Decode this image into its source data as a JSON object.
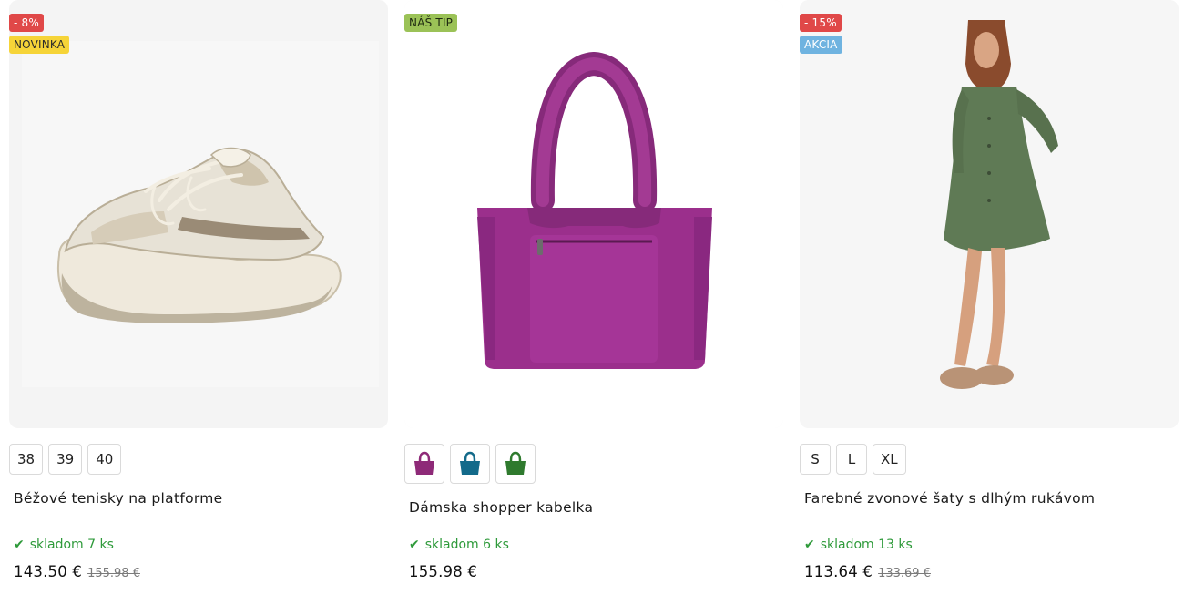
{
  "colors": {
    "badge_discount": "#e04848",
    "badge_new": "#f6d438",
    "badge_tip": "#9bc257",
    "badge_sale": "#6fb3e0",
    "in_stock": "#2e9a3a"
  },
  "products": [
    {
      "badges": [
        "- 8%",
        "NOVINKA"
      ],
      "image": "beige-platform-sneaker",
      "sizes": [
        "38",
        "39",
        "40"
      ],
      "title": "Béžové tenisky na platforme",
      "stock_icon": "check-icon",
      "stock": "skladom 7 ks",
      "price": "143.50 €",
      "old_price": "155.98 €"
    },
    {
      "badges": [
        "NÁŠ TIP"
      ],
      "image": "purple-shopper-bag",
      "swatches": [
        {
          "name": "purple",
          "color": "#8e2a78"
        },
        {
          "name": "teal",
          "color": "#136a8a"
        },
        {
          "name": "green",
          "color": "#2f7a2e"
        }
      ],
      "title": "Dámska shopper kabelka",
      "stock_icon": "check-icon",
      "stock": "skladom 6 ks",
      "price": "155.98 €",
      "old_price": ""
    },
    {
      "badges": [
        "- 15%",
        "AKCIA"
      ],
      "image": "green-shirt-dress-model",
      "sizes": [
        "S",
        "L",
        "XL"
      ],
      "title": "Farebné zvonové šaty s dlhým rukávom",
      "stock_icon": "check-icon",
      "stock": "skladom 13 ks",
      "price": "113.64 €",
      "old_price": "133.69 €"
    }
  ]
}
